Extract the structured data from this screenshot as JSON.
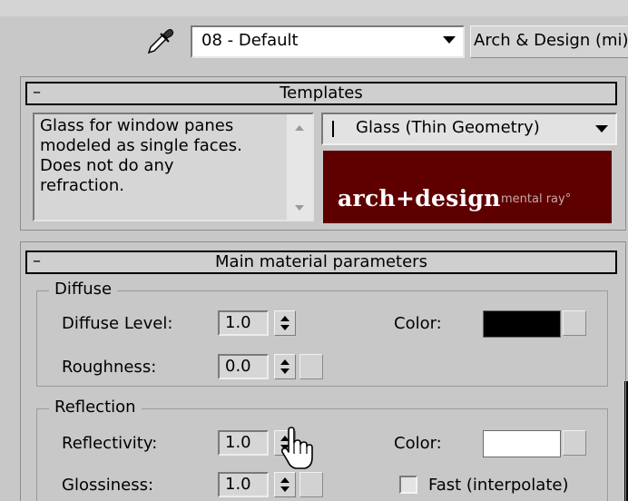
{
  "material": {
    "name": "08 - Default",
    "type_button": "Arch & Design (mi)"
  },
  "templates": {
    "title": "Templates",
    "collapse_symbol": "–",
    "description_lines": [
      "Glass for window panes",
      "modeled as single faces.",
      "Does not do any",
      "refraction."
    ],
    "selected_template": "Glass (Thin Geometry)",
    "logo_main": "arch+design",
    "logo_sub": "mental ray°"
  },
  "main_params": {
    "title": "Main material parameters",
    "collapse_symbol": "–",
    "diffuse": {
      "group_label": "Diffuse",
      "level_label": "Diffuse Level:",
      "level_value": "1.0",
      "roughness_label": "Roughness:",
      "roughness_value": "0.0",
      "color_label": "Color:",
      "color": "#000000"
    },
    "reflection": {
      "group_label": "Reflection",
      "reflectivity_label": "Reflectivity:",
      "reflectivity_value": "1.0",
      "glossiness_label": "Glossiness:",
      "glossiness_value": "1.0",
      "color_label": "Color:",
      "color": "#ffffff",
      "fast_label": "Fast (interpolate)",
      "fast_checked": false
    }
  },
  "icons": [
    "eyedropper-icon",
    "hand-cursor-icon"
  ],
  "colors": {
    "panel_bg": "#c8c8c8",
    "logo_bg": "#5e0000"
  }
}
